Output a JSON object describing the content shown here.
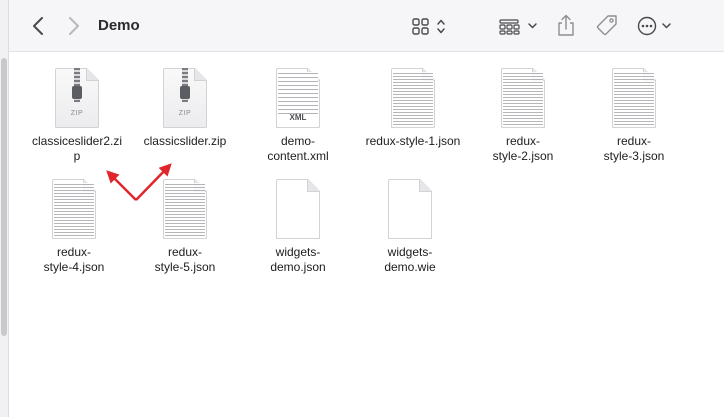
{
  "window": {
    "title": "Demo"
  },
  "files": [
    {
      "name": "classiceslider2.zip",
      "label": "classiceslider2.zi\np",
      "kind": "zip",
      "badge": "ZIP"
    },
    {
      "name": "classicslider.zip",
      "label": "classicslider.zip",
      "kind": "zip",
      "badge": "ZIP"
    },
    {
      "name": "demo-content.xml",
      "label": "demo-\ncontent.xml",
      "kind": "xml",
      "badge": "XML"
    },
    {
      "name": "redux-style-1.json",
      "label": "redux-style-1.json",
      "kind": "text"
    },
    {
      "name": "redux-style-2.json",
      "label": "redux-\nstyle-2.json",
      "kind": "text"
    },
    {
      "name": "redux-style-3.json",
      "label": "redux-\nstyle-3.json",
      "kind": "text"
    },
    {
      "name": "redux-style-4.json",
      "label": "redux-\nstyle-4.json",
      "kind": "text"
    },
    {
      "name": "redux-style-5.json",
      "label": "redux-\nstyle-5.json",
      "kind": "text"
    },
    {
      "name": "widgets-demo.json",
      "label": "widgets-\ndemo.json",
      "kind": "blank"
    },
    {
      "name": "widgets-demo.wie",
      "label": "widgets-\ndemo.wie",
      "kind": "blank"
    }
  ],
  "icons": {
    "back": "chevron-left-icon",
    "forward": "chevron-right-icon",
    "view": "grid-view-icon",
    "group": "group-by-icon",
    "share": "share-icon",
    "tag": "tag-icon",
    "more": "ellipsis-circle-icon"
  },
  "colors": {
    "annotation_arrow": "#e0262b",
    "toolbar_bg": "#f6f5f7"
  }
}
